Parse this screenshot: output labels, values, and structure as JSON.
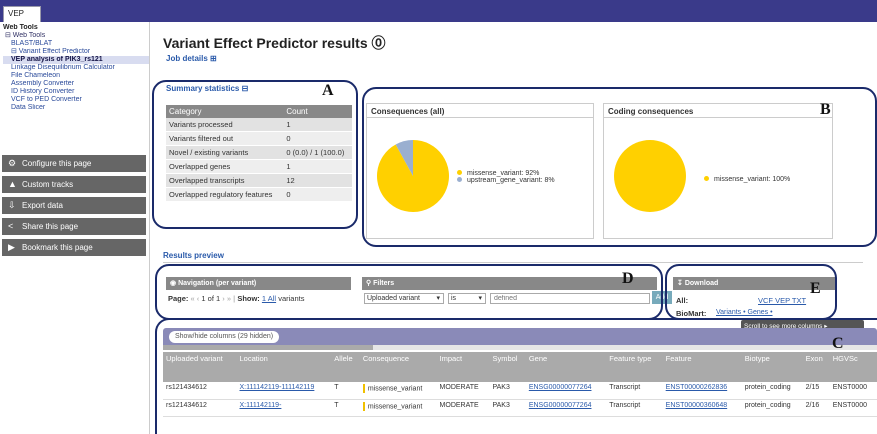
{
  "tab": "VEP",
  "sidebar": {
    "tree": [
      {
        "label": "Web Tools",
        "level": 0
      },
      {
        "label": "⊟ Web Tools",
        "level": 1
      },
      {
        "label": "BLAST/BLAT",
        "level": 2
      },
      {
        "label": "⊟ Variant Effect Predictor",
        "level": 2
      },
      {
        "label": "VEP analysis of PIK3_rs121",
        "level": 2,
        "selected": true
      },
      {
        "label": "Linkage Disequilibrium Calculator",
        "level": 2
      },
      {
        "label": "File Chameleon",
        "level": 2
      },
      {
        "label": "Assembly Converter",
        "level": 2
      },
      {
        "label": "ID History Converter",
        "level": 2
      },
      {
        "label": "VCF to PED Converter",
        "level": 2
      },
      {
        "label": "Data Slicer",
        "level": 2
      }
    ],
    "buttons": [
      {
        "label": "Configure this page",
        "icon": "gear-icon",
        "glyph": "⚙"
      },
      {
        "label": "Custom tracks",
        "icon": "custom-tracks-icon",
        "glyph": "▲"
      },
      {
        "label": "Export data",
        "icon": "export-icon",
        "glyph": "⇩"
      },
      {
        "label": "Share this page",
        "icon": "share-icon",
        "glyph": "<"
      },
      {
        "label": "Bookmark this page",
        "icon": "bookmark-icon",
        "glyph": "▶"
      }
    ]
  },
  "title": "Variant Effect Predictor results ⓪",
  "job_details": "Job details ⊞",
  "summary_statistics": "Summary statistics ⊟",
  "stats": {
    "headers": [
      "Category",
      "Count"
    ],
    "rows": [
      [
        "Variants processed",
        "1"
      ],
      [
        "Variants filtered out",
        "0"
      ],
      [
        "Novel / existing variants",
        "0 (0.0) / 1 (100.0)"
      ],
      [
        "Overlapped genes",
        "1"
      ],
      [
        "Overlapped transcripts",
        "12"
      ],
      [
        "Overlapped regulatory features",
        "0"
      ]
    ]
  },
  "consequences": {
    "title": "Consequences (all)",
    "legend": [
      "missense_variant: 92%",
      "upstream_gene_variant: 8%"
    ],
    "chart_data": {
      "type": "pie",
      "categories": [
        "missense_variant",
        "upstream_gene_variant"
      ],
      "values": [
        92,
        8
      ],
      "colors": [
        "#ffd000",
        "#9aafd0"
      ]
    }
  },
  "coding": {
    "title": "Coding consequences",
    "legend": [
      "missense_variant: 100%"
    ],
    "chart_data": {
      "type": "pie",
      "categories": [
        "missense_variant"
      ],
      "values": [
        100
      ],
      "colors": [
        "#ffd000"
      ]
    }
  },
  "results_preview": "Results preview",
  "navigation": {
    "header": "Navigation",
    "header_small": "(per variant)",
    "page_label": "Page:",
    "page_text": "1 of 1",
    "show_label": "Show:",
    "show_link": "1 All",
    "show_suffix": "variants"
  },
  "filters": {
    "header": "Filters",
    "field": "Uploaded variant",
    "op": "is",
    "value_placeholder": "defined",
    "add": "Add"
  },
  "download": {
    "header": "Download",
    "all_label": "All:",
    "all_links": "VCF VEP TXT",
    "biomart_label": "BioMart:",
    "biomart_link": "Variants • Genes •"
  },
  "scroll_tip": "Scroll to see more columns ▸",
  "showhide": "Show/hide columns (29 hidden)",
  "box_labels": [
    "A",
    "B",
    "C",
    "D",
    "E"
  ],
  "results": {
    "headers": [
      "Uploaded variant",
      "Location",
      "Allele",
      "Consequence",
      "Impact",
      "Symbol",
      "Gene",
      "Feature type",
      "Feature",
      "Biotype",
      "Exon",
      "HGVSc"
    ],
    "rows": [
      [
        "rs121434612",
        "X:111142119-111142119",
        "T",
        "missense_variant",
        "MODERATE",
        "PAK3",
        "ENSG00000077264",
        "Transcript",
        "ENST00000262836",
        "protein_coding",
        "2/15",
        "ENST0000"
      ],
      [
        "rs121434612",
        "X:111142119-",
        "T",
        "missense_variant",
        "MODERATE",
        "PAK3",
        "ENSG00000077264",
        "Transcript",
        "ENST00000360648",
        "protein_coding",
        "2/16",
        "ENST0000"
      ]
    ]
  }
}
